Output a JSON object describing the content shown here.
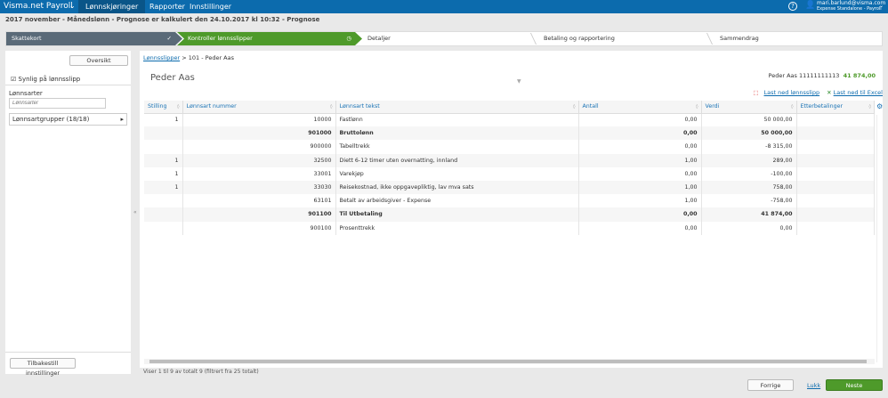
{
  "topbar": {
    "brand": "Visma.net Payroll",
    "nav": [
      "Lønnskjøringer",
      "Rapporter",
      "Innstillinger"
    ],
    "user_email": "mari.barlund@visma.com",
    "user_context": "Expense Standalone - Payroll"
  },
  "subheader": "2017 november - Månedslønn - Prognose er kalkulert den 24.10.2017 kl 10:32 - Prognose",
  "steps": [
    "Skattekort",
    "Kontroller lønnsslipper",
    "Detaljer",
    "Betaling og rapportering",
    "Sammendrag"
  ],
  "left": {
    "overview_button": "Oversikt",
    "visible_checkbox": "Synlig på lønnsslipp",
    "wage_types_label": "Lønnsarter",
    "wage_types_placeholder": "Lønnsarter",
    "groups": "Lønnsartgrupper (18/18)",
    "reset_button": "Tilbakestill innstillinger"
  },
  "main": {
    "breadcrumb_link": "Lønnsslipper",
    "breadcrumb_current": "101 - Peder Aas",
    "title": "Peder Aas",
    "employee": "Peder Aas 11111111113",
    "employee_total": "41 874,00",
    "download_payslip": "Last ned lønnsslipp",
    "download_excel": "Last ned til Excel"
  },
  "table": {
    "headers": [
      "Stilling",
      "Lønnsart nummer",
      "Lønnsart tekst",
      "Antall",
      "Verdi",
      "Etterbetalinger"
    ],
    "rows": [
      {
        "stilling": "1",
        "nummer": "10000",
        "tekst": "Fastlønn",
        "antall": "0,00",
        "verdi": "50 000,00",
        "bold": false
      },
      {
        "stilling": "",
        "nummer": "901000",
        "tekst": "Bruttolønn",
        "antall": "0,00",
        "verdi": "50 000,00",
        "bold": true
      },
      {
        "stilling": "",
        "nummer": "900000",
        "tekst": "Tabelltrekk",
        "antall": "0,00",
        "verdi": "-8 315,00",
        "bold": false
      },
      {
        "stilling": "1",
        "nummer": "32500",
        "tekst": "Diett 6-12 timer uten overnatting, innland",
        "antall": "1,00",
        "verdi": "289,00",
        "bold": false
      },
      {
        "stilling": "1",
        "nummer": "33001",
        "tekst": "Varekjøp",
        "antall": "0,00",
        "verdi": "-100,00",
        "bold": false
      },
      {
        "stilling": "1",
        "nummer": "33030",
        "tekst": "Reisekostnad, ikke oppgavepliktig, lav mva sats",
        "antall": "1,00",
        "verdi": "758,00",
        "bold": false
      },
      {
        "stilling": "",
        "nummer": "63101",
        "tekst": "Betalt av arbeidsgiver - Expense",
        "antall": "1,00",
        "verdi": "-758,00",
        "bold": false
      },
      {
        "stilling": "",
        "nummer": "901100",
        "tekst": "Til Utbetaling",
        "antall": "0,00",
        "verdi": "41 874,00",
        "bold": true
      },
      {
        "stilling": "",
        "nummer": "900100",
        "tekst": "Prosenttrekk",
        "antall": "0,00",
        "verdi": "0,00",
        "bold": false
      }
    ]
  },
  "footer": {
    "info": "Viser 1 til 9 av totalt 9 (filtrert fra 25 totalt)",
    "prev": "Forrige",
    "close": "Lukk",
    "next": "Neste"
  }
}
